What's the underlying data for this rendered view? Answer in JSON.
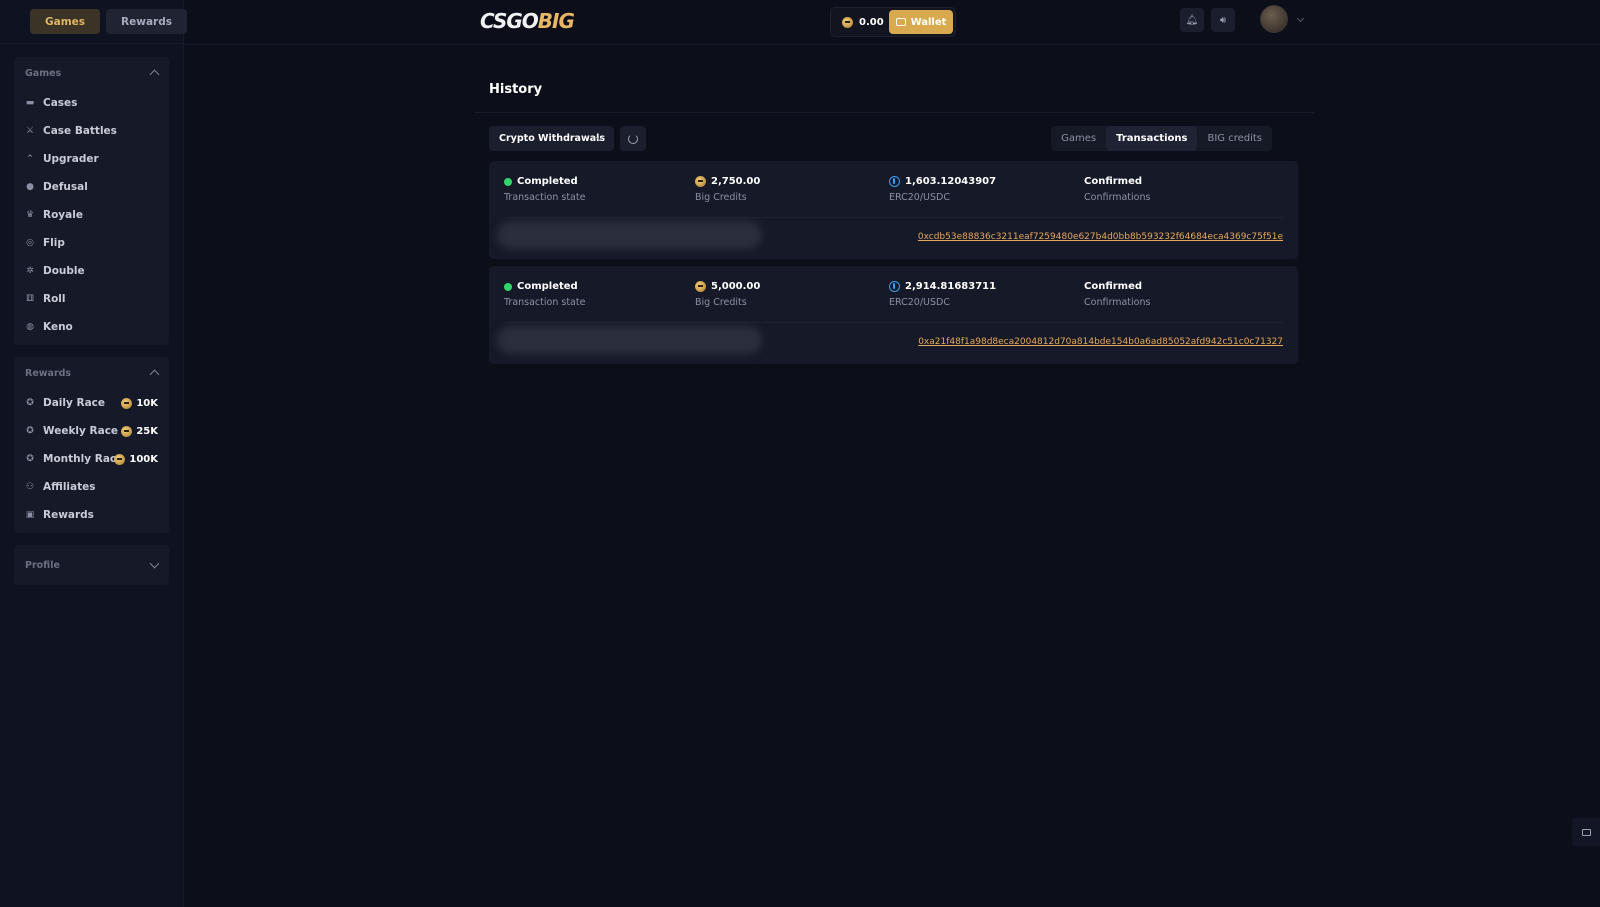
{
  "topbar": {
    "tabs": [
      {
        "label": "Games",
        "active": true
      },
      {
        "label": "Rewards",
        "active": false
      }
    ],
    "logo": {
      "part1": "CSGO",
      "part2": "BIG"
    },
    "balance": "0.00",
    "wallet_label": "Wallet",
    "icons": {
      "menu": "menu-icon",
      "notifications": "bell-icon",
      "sound": "speaker-icon",
      "coin": "big-credit-coin-icon",
      "wallet": "wallet-icon"
    }
  },
  "sidebar": {
    "games_section": {
      "title": "Games",
      "items": [
        {
          "label": "Cases",
          "icon": "case-icon"
        },
        {
          "label": "Case Battles",
          "icon": "battle-icon"
        },
        {
          "label": "Upgrader",
          "icon": "upgrade-icon"
        },
        {
          "label": "Defusal",
          "icon": "bomb-icon"
        },
        {
          "label": "Royale",
          "icon": "crown-icon"
        },
        {
          "label": "Flip",
          "icon": "coin-flip-icon"
        },
        {
          "label": "Double",
          "icon": "roulette-icon"
        },
        {
          "label": "Roll",
          "icon": "dice-icon"
        },
        {
          "label": "Keno",
          "icon": "keno-icon"
        }
      ]
    },
    "rewards_section": {
      "title": "Rewards",
      "items": [
        {
          "label": "Daily Race",
          "icon": "race-icon",
          "value": "10K"
        },
        {
          "label": "Weekly Race",
          "icon": "race-icon",
          "value": "25K"
        },
        {
          "label": "Monthly Race",
          "icon": "race-icon",
          "value": "100K"
        },
        {
          "label": "Affiliates",
          "icon": "user-plus-icon",
          "value": ""
        },
        {
          "label": "Rewards",
          "icon": "gift-icon",
          "value": ""
        }
      ]
    },
    "profile_section": {
      "title": "Profile"
    }
  },
  "history": {
    "title": "History",
    "filter": "Crypto Withdrawals",
    "segments": [
      {
        "label": "Games",
        "active": false
      },
      {
        "label": "Transactions",
        "active": true
      },
      {
        "label": "BIG credits",
        "active": false
      }
    ],
    "transactions": [
      {
        "state": "Completed",
        "state_label": "Transaction state",
        "credits": "2,750.00",
        "credits_label": "Big Credits",
        "crypto_amount": "1,603.12043907",
        "crypto_label": "ERC20/USDC",
        "confirmations": "Confirmed",
        "confirmations_label": "Confirmations",
        "tx_hash": "0xcdb53e88836c3211eaf7259480e627b4d0bb8b593232f64684eca4369c75f51e"
      },
      {
        "state": "Completed",
        "state_label": "Transaction state",
        "credits": "5,000.00",
        "credits_label": "Big Credits",
        "crypto_amount": "2,914.81683711",
        "crypto_label": "ERC20/USDC",
        "confirmations": "Confirmed",
        "confirmations_label": "Confirmations",
        "tx_hash": "0xa21f48f1a98d8eca2004812d70a814bde154b0a6ad85052afd942c51c0c71327"
      }
    ]
  },
  "colors": {
    "accent": "#d8a94e",
    "link": "#e7a756",
    "success": "#34d36b",
    "background": "#0c0f1a"
  }
}
